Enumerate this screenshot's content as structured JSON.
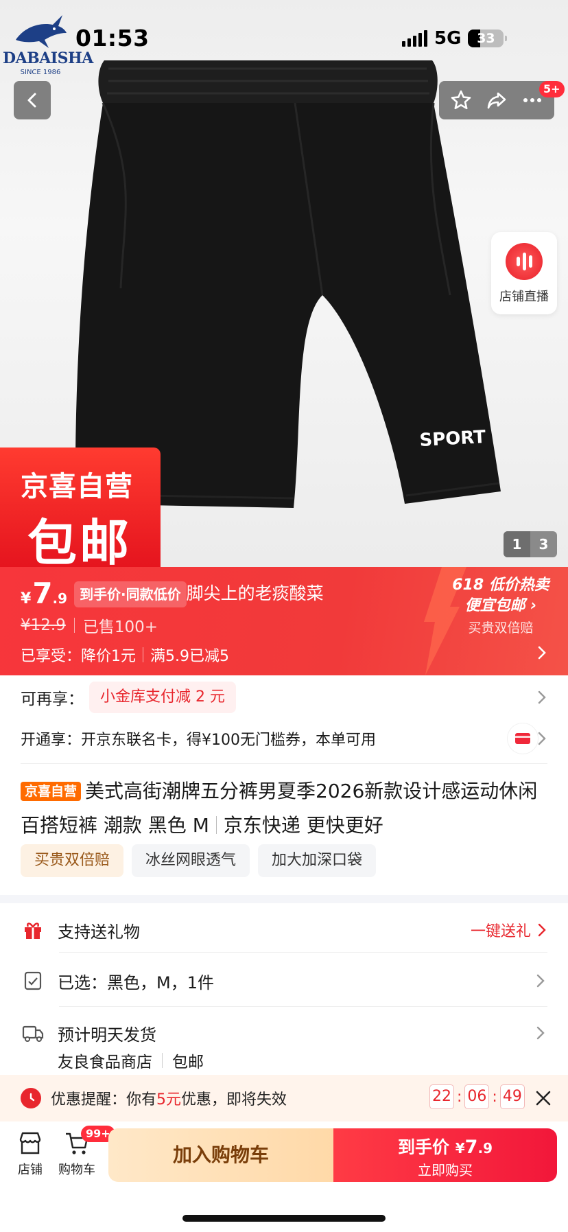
{
  "status_bar": {
    "time": "01:53",
    "network": "5G",
    "battery": "33"
  },
  "brand": {
    "name": "DABAISHA",
    "since": "SINCE 1986"
  },
  "product_image": {
    "print": "SPORT",
    "current_index": "1",
    "total": "3"
  },
  "header": {
    "message_badge": "5+"
  },
  "live": {
    "label": "店铺直播"
  },
  "promo_box": {
    "line1": "京喜自营",
    "line2": "包邮"
  },
  "price": {
    "currency": "¥",
    "integer": "7",
    "decimal": ".9",
    "deal_tag": "到手价·同款低价",
    "shop_overlay": "脚尖上的老痰酸菜",
    "original": "¥12.9",
    "sold": "已售100+",
    "enjoyed_label": "已享受：",
    "enjoyed_1": "降价1元",
    "enjoyed_2": "满5.9已减5"
  },
  "campaign": {
    "line1": "618 低价热卖",
    "line2": "便宜包邮 ›",
    "line3": "买贵双倍赔"
  },
  "extra_offer": {
    "label": "可再享：",
    "coupon": "小金库支付减 2 元"
  },
  "open_offer": {
    "text": "开通享：开京东联名卡，得¥100无门槛券，本单可用"
  },
  "title": {
    "badge": "京喜自营",
    "text": "美式高街潮牌五分裤男夏季2026新款设计感运动休闲百搭短裤 潮款 黑色 M",
    "suffix": "京东快递 更快更好"
  },
  "tags": [
    "买贵双倍赔",
    "冰丝网眼透气",
    "加大加深口袋"
  ],
  "services": {
    "gift": {
      "label": "支持送礼物",
      "link": "一键送礼"
    },
    "selected": {
      "label": "已选：黑色，M，1件"
    },
    "shipping": {
      "label": "预计明天发货",
      "store": "友良食品商店",
      "free": "包邮"
    }
  },
  "reminder": {
    "prefix": "优惠提醒：你有",
    "amount": "5元",
    "suffix": "优惠，即将失效",
    "hh": "22",
    "mm": "06",
    "ss": "49"
  },
  "bottom_bar": {
    "store_label": "店铺",
    "cart_label": "购物车",
    "cart_badge": "99+",
    "add_to_cart": "加入购物车",
    "buy_price_label": "到手价",
    "buy_currency": "¥",
    "buy_price_int": "7",
    "buy_price_dec": ".9",
    "buy_now": "立即购买"
  },
  "colors": {
    "accent_red": "#e8262d",
    "price_band": "#f13a3a",
    "gold_button": "#ffe0b8"
  }
}
